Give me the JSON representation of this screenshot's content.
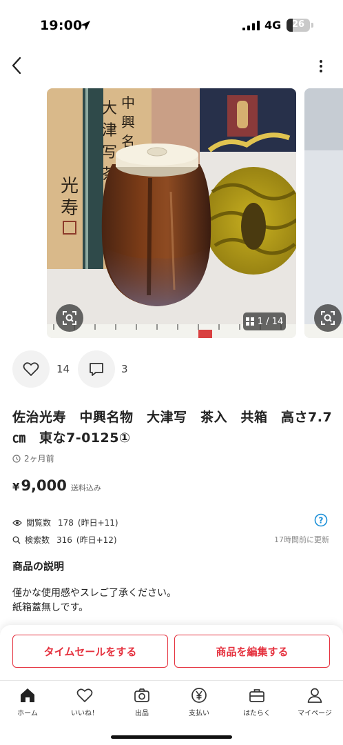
{
  "status_bar": {
    "time": "19:00",
    "network": "4G",
    "battery": "26",
    "battery_level": 0.26
  },
  "nav": {
    "back_icon": "chevron-left-icon",
    "more_icon": "more-vertical-icon"
  },
  "gallery": {
    "counter": "1 / 14",
    "current": 1,
    "total": 14
  },
  "engagement": {
    "likes": "14",
    "comments": "3"
  },
  "item": {
    "title": "佐治光寿　中興名物　大津写　茶入　共箱　高さ7.7㎝　東な7-0125①",
    "posted": "2ヶ月前",
    "price_symbol": "¥",
    "price": "9,000",
    "shipping_note": "送料込み"
  },
  "stats": {
    "views_label": "閲覧数",
    "views": "178",
    "views_delta": "(昨日+11)",
    "searches_label": "検索数",
    "searches": "316",
    "searches_delta": "(昨日+12)",
    "updated": "17時間前に更新"
  },
  "description": {
    "heading": "商品の説明",
    "lines": [
      "僅かな使用感やスレご了承ください。",
      "紙箱蓋無しです。"
    ]
  },
  "actions": {
    "time_sale": "タイムセールをする",
    "edit": "商品を編集する"
  },
  "tabs": [
    {
      "label": "ホーム",
      "icon": "home-icon"
    },
    {
      "label": "いいね！",
      "icon": "heart-icon"
    },
    {
      "label": "出品",
      "icon": "camera-icon"
    },
    {
      "label": "支払い",
      "icon": "yen-icon"
    },
    {
      "label": "はたらく",
      "icon": "briefcase-icon"
    },
    {
      "label": "マイページ",
      "icon": "person-icon"
    }
  ],
  "colors": {
    "accent": "#e5323f",
    "help": "#1a8fd8"
  }
}
